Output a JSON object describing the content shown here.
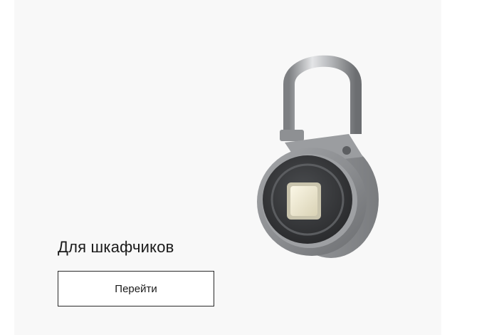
{
  "card": {
    "title": "Для шкафчиков",
    "button_label": "Перейти",
    "image_icon": "smart-fingerprint-padlock"
  },
  "colors": {
    "card_background": "#f8f8f8",
    "button_border": "#2a2a2a",
    "text": "#1a1a1a"
  }
}
